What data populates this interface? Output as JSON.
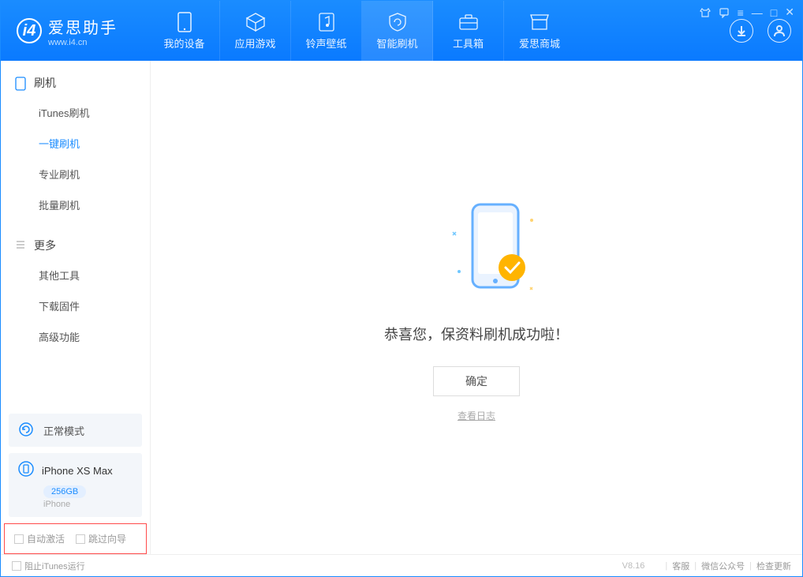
{
  "app": {
    "title": "爱思助手",
    "subtitle": "www.i4.cn"
  },
  "tabs": {
    "t0": "我的设备",
    "t1": "应用游戏",
    "t2": "铃声壁纸",
    "t3": "智能刷机",
    "t4": "工具箱",
    "t5": "爱思商城"
  },
  "sidebar": {
    "sec1": "刷机",
    "items1": {
      "i0": "iTunes刷机",
      "i1": "一键刷机",
      "i2": "专业刷机",
      "i3": "批量刷机"
    },
    "sec2": "更多",
    "items2": {
      "i0": "其他工具",
      "i1": "下载固件",
      "i2": "高级功能"
    },
    "status": "正常模式",
    "device": {
      "name": "iPhone XS Max",
      "storage": "256GB",
      "type": "iPhone"
    },
    "opts": {
      "o0": "自动激活",
      "o1": "跳过向导"
    }
  },
  "main": {
    "msg": "恭喜您，保资料刷机成功啦！",
    "ok": "确定",
    "log": "查看日志"
  },
  "footer": {
    "block": "阻止iTunes运行",
    "version": "V8.16",
    "l0": "客服",
    "l1": "微信公众号",
    "l2": "检查更新"
  }
}
